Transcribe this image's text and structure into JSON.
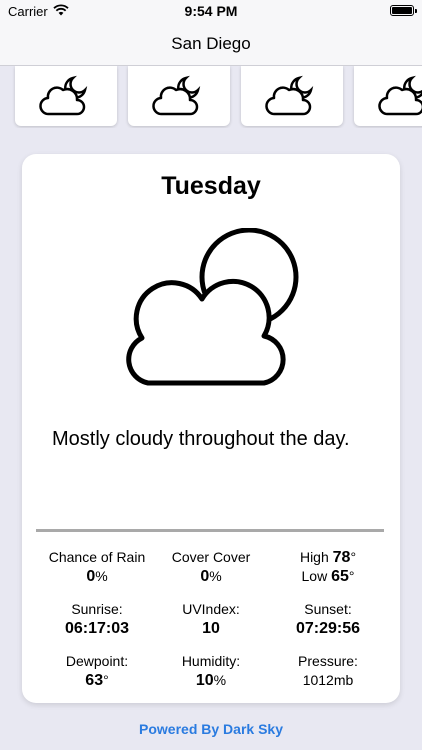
{
  "status_bar": {
    "carrier": "Carrier",
    "time": "9:54 PM"
  },
  "nav": {
    "title": "San Diego"
  },
  "forecast_strip": {
    "icon": "partly-cloudy-night-icon",
    "visible_cards": 4
  },
  "card": {
    "day": "Tuesday",
    "icon": "partly-cloudy-day-icon",
    "summary": "Mostly cloudy throughout the day.",
    "rows": [
      [
        {
          "label": "Chance of Rain",
          "value": "0",
          "unit": "%"
        },
        {
          "label": "Cover Cover",
          "value": "0",
          "unit": "%"
        },
        {
          "high_label": "High",
          "high_value": "78",
          "high_unit": "°",
          "low_label": "Low",
          "low_value": "65",
          "low_unit": "°"
        }
      ],
      [
        {
          "label": "Sunrise:",
          "value": "06:17:03"
        },
        {
          "label": "UVIndex:",
          "value": "10"
        },
        {
          "label": "Sunset:",
          "value": "07:29:56"
        }
      ],
      [
        {
          "label": "Dewpoint:",
          "value": "63",
          "unit": "°"
        },
        {
          "label": "Humidity:",
          "value": "10",
          "unit": "%"
        },
        {
          "label": "Pressure:",
          "value_plain": "1012mb"
        }
      ]
    ]
  },
  "footer": {
    "powered_by": "Powered By Dark Sky"
  },
  "colors": {
    "link": "#2a7be0",
    "background": "#e8e8f2",
    "card": "#ffffff"
  }
}
